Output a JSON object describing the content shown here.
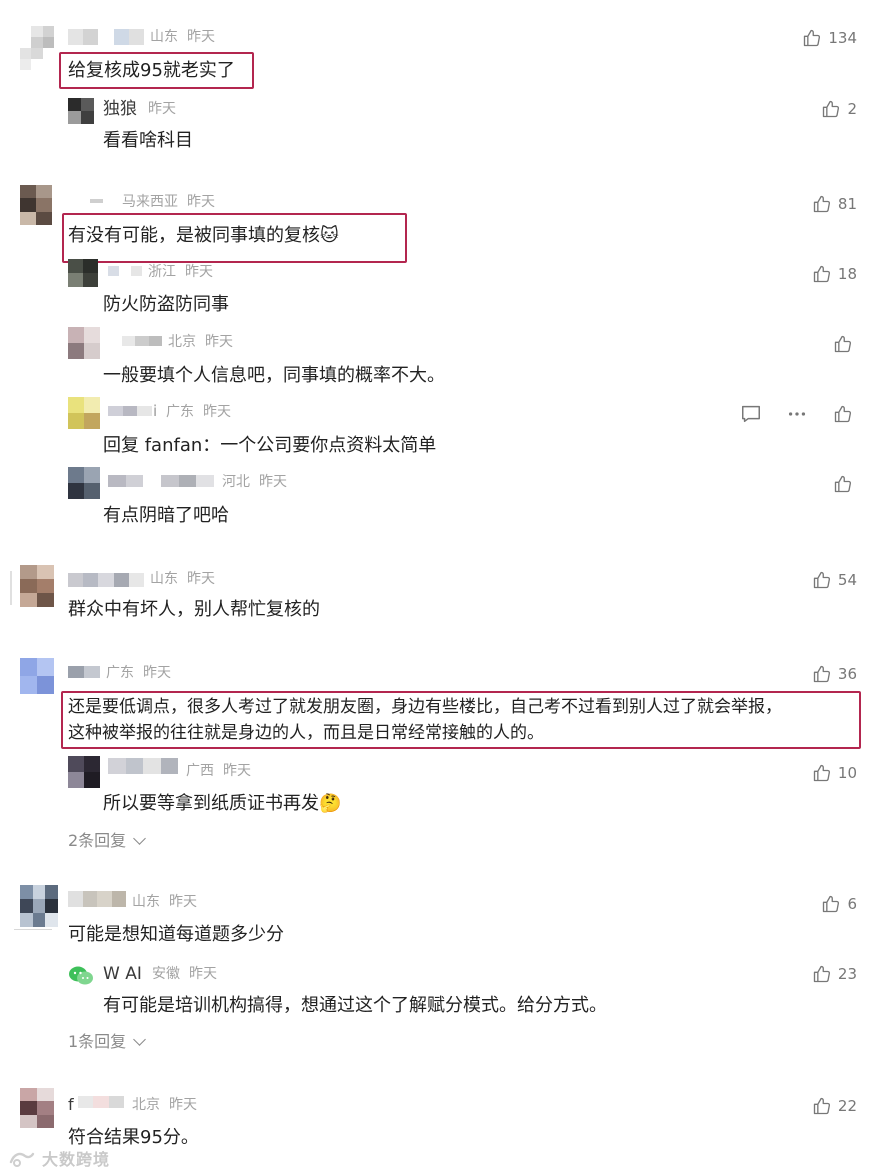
{
  "reply_labels": {
    "replies2": "2条回复",
    "replies1": "1条回复"
  },
  "watermark": {
    "text": "大数跨境"
  },
  "comments": {
    "c1": {
      "location": "山东",
      "time": "昨天",
      "likes": "134",
      "text": "给复核成95就老实了"
    },
    "c1r1": {
      "name": "独狼",
      "time": "昨天",
      "likes": "2",
      "text": "看看啥科目"
    },
    "c2": {
      "location": "马来西亚",
      "time": "昨天",
      "likes": "81",
      "text": "有没有可能，是被同事填的复核🐱"
    },
    "c2r1": {
      "location": "浙江",
      "time": "昨天",
      "likes": "18",
      "text": "防火防盗防同事"
    },
    "c2r2": {
      "location": "北京",
      "time": "昨天",
      "text": "一般要填个人信息吧，同事填的概率不大。"
    },
    "c2r3": {
      "name_fragment": "i",
      "location": "广东",
      "time": "昨天",
      "text": "回复 fanfan：一个公司要你点资料太简单"
    },
    "c2r4": {
      "location": "河北",
      "time": "昨天",
      "text": "有点阴暗了吧哈"
    },
    "c3": {
      "location": "山东",
      "time": "昨天",
      "likes": "54",
      "text": "群众中有坏人，别人帮忙复核的"
    },
    "c4": {
      "location": "广东",
      "time": "昨天",
      "likes": "36",
      "text_line1": "还是要低调点，很多人考过了就发朋友圈，身边有些楼比，自己考不过看到别人过了就会举报，",
      "text_line2": "这种被举报的往往就是身边的人，而且是日常经常接触的人的。"
    },
    "c4r1": {
      "location": "广西",
      "time": "昨天",
      "likes": "10",
      "text": "所以要等拿到纸质证书再发🤔"
    },
    "c5": {
      "location": "山东",
      "time": "昨天",
      "likes": "6",
      "text": "可能是想知道每道题多少分"
    },
    "c5r1": {
      "name": "W AI",
      "location": "安徽",
      "time": "昨天",
      "likes": "23",
      "text": "有可能是培训机构搞得，想通过这个了解赋分模式。给分方式。"
    },
    "c6": {
      "name_fragment": "f",
      "location": "北京",
      "time": "昨天",
      "likes": "22",
      "text": "符合结果95分。"
    }
  },
  "colors": {
    "highlight": "#b3264f",
    "meta": "#a3a3a3"
  },
  "icons": {
    "like": "thumbs-up-icon",
    "reply": "chat-bubble-icon",
    "more": "more-dots-icon",
    "chevron": "chevron-down-icon"
  }
}
